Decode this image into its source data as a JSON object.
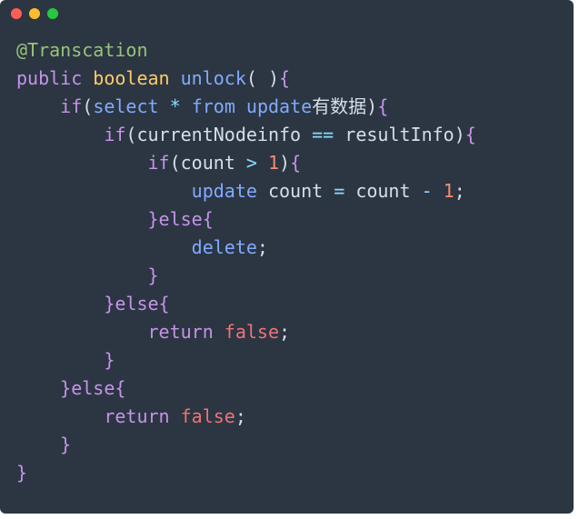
{
  "annotation": "@Transcation",
  "kw_public": "public",
  "kw_boolean": "boolean",
  "fn_unlock": "unlock",
  "parens_empty": "( )",
  "brace_open": "{",
  "brace_close": "}",
  "kw_if": "if",
  "kw_else": "else",
  "kw_return": "return",
  "kw_false": "false",
  "kw_select": "select",
  "kw_from": "from",
  "kw_update": "update",
  "kw_delete": "delete",
  "star": "*",
  "text_update_has_data": "有数据",
  "id_currentNodeinfo": "currentNodeinfo",
  "id_resultInfo": "resultInfo",
  "id_count": "count",
  "op_eq": "==",
  "op_gt": ">",
  "op_assign": "=",
  "op_minus": "-",
  "lit_1": "1",
  "semi": ";",
  "paren_open": "(",
  "paren_close": ")"
}
